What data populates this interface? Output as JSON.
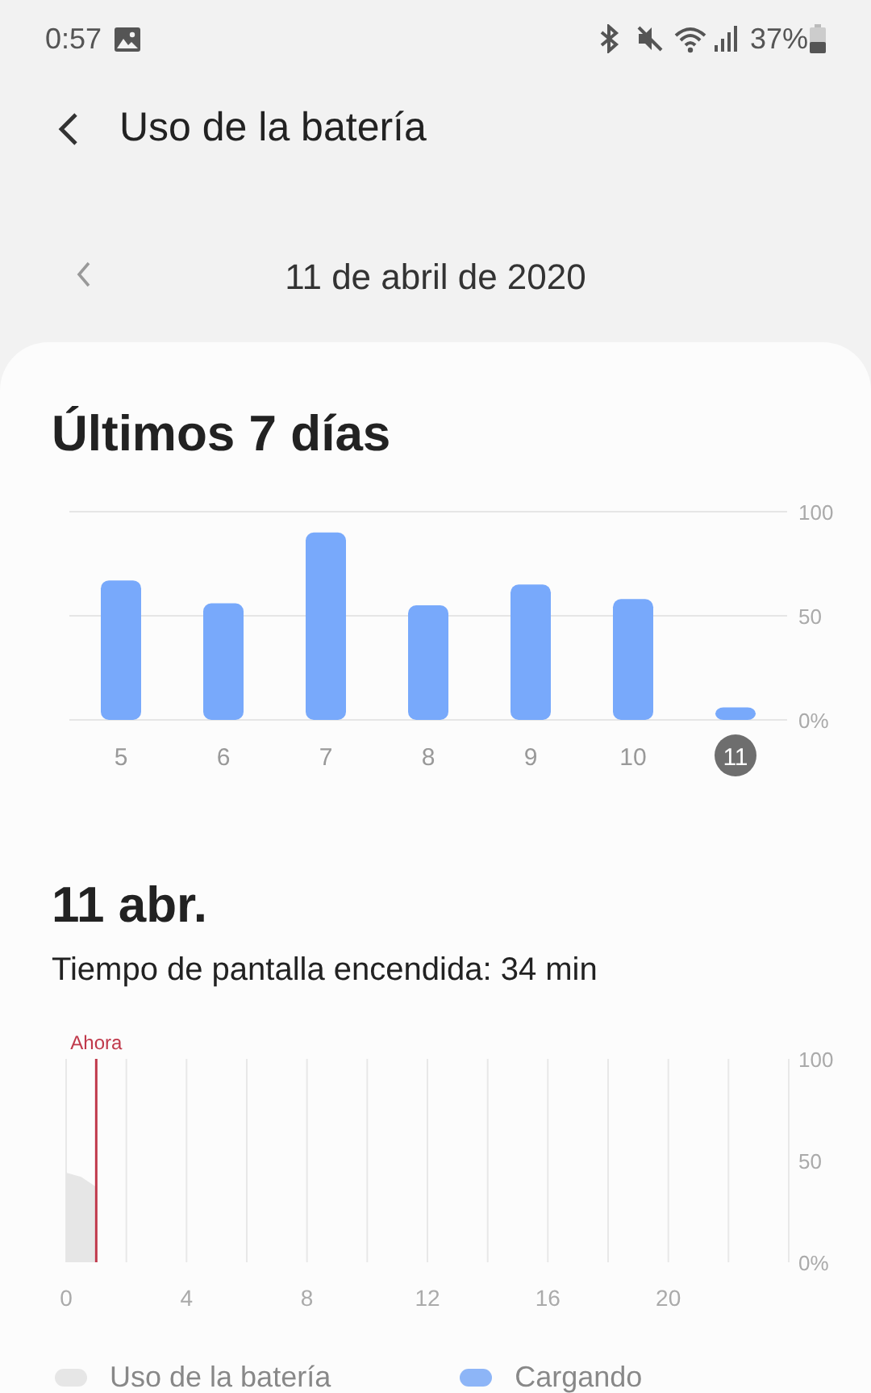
{
  "status_bar": {
    "time": "0:57",
    "battery_text": "37%"
  },
  "header": {
    "title": "Uso de la batería"
  },
  "date_nav": {
    "date": "11 de abril de 2020"
  },
  "week": {
    "title": "Últimos 7 días",
    "selected_day": "11",
    "chart_data": {
      "type": "bar",
      "categories": [
        "5",
        "6",
        "7",
        "8",
        "9",
        "10",
        "11"
      ],
      "series": [
        {
          "color": "#78a9fb",
          "values": [
            67,
            56,
            90,
            55,
            65,
            58,
            6
          ]
        }
      ],
      "ylim": [
        0,
        100
      ],
      "yticks": [
        {
          "value": 0,
          "label": "0%"
        },
        {
          "value": 50,
          "label": "50"
        },
        {
          "value": 100,
          "label": "100"
        }
      ]
    }
  },
  "day": {
    "title": "11 abr.",
    "screen_time": "Tiempo de pantalla encendida: 34 min",
    "chart_data": {
      "type": "area",
      "x": [
        0,
        0.5,
        1
      ],
      "series": [
        {
          "name": "Uso de la batería",
          "color": "#e6e6e6",
          "values": [
            44,
            42,
            37
          ]
        },
        {
          "name": "Cargando",
          "color": "#8db5f7",
          "values": [
            null,
            null,
            null
          ]
        }
      ],
      "xlim": [
        0,
        24
      ],
      "ylim": [
        0,
        100
      ],
      "xticks": [
        0,
        4,
        8,
        12,
        16,
        20
      ],
      "yticks": [
        {
          "value": 0,
          "label": "0%"
        },
        {
          "value": 50,
          "label": "50"
        },
        {
          "value": 100,
          "label": "100"
        }
      ],
      "grid": true,
      "ref_lines": [
        {
          "axis": "x",
          "value": 1,
          "label": "Ahora",
          "color": "#c0394b"
        }
      ]
    }
  }
}
